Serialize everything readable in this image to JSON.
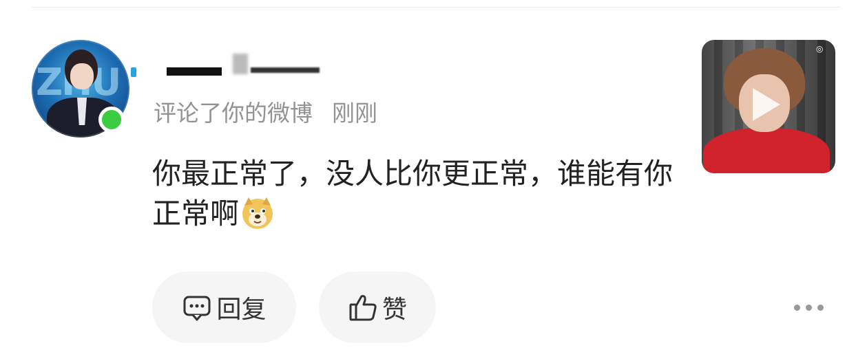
{
  "comment": {
    "action_text": "评论了你的微博",
    "time": "刚刚",
    "text": "你最正常了，没人比你更正常，谁能有你正常啊"
  },
  "avatar": {
    "status": "online",
    "status_color": "#3ccc3f",
    "lettering": "ZHU"
  },
  "actions": {
    "reply_label": "回复",
    "like_label": "赞"
  },
  "icons": {
    "emoji": "doge-emoji-icon",
    "reply": "comment-bubble-icon",
    "like": "thumbs-up-icon",
    "more": "more-horizontal-icon",
    "play": "play-icon"
  },
  "colors": {
    "meta_text": "#939393",
    "body_text": "#222222",
    "button_bg": "#f5f5f5"
  }
}
